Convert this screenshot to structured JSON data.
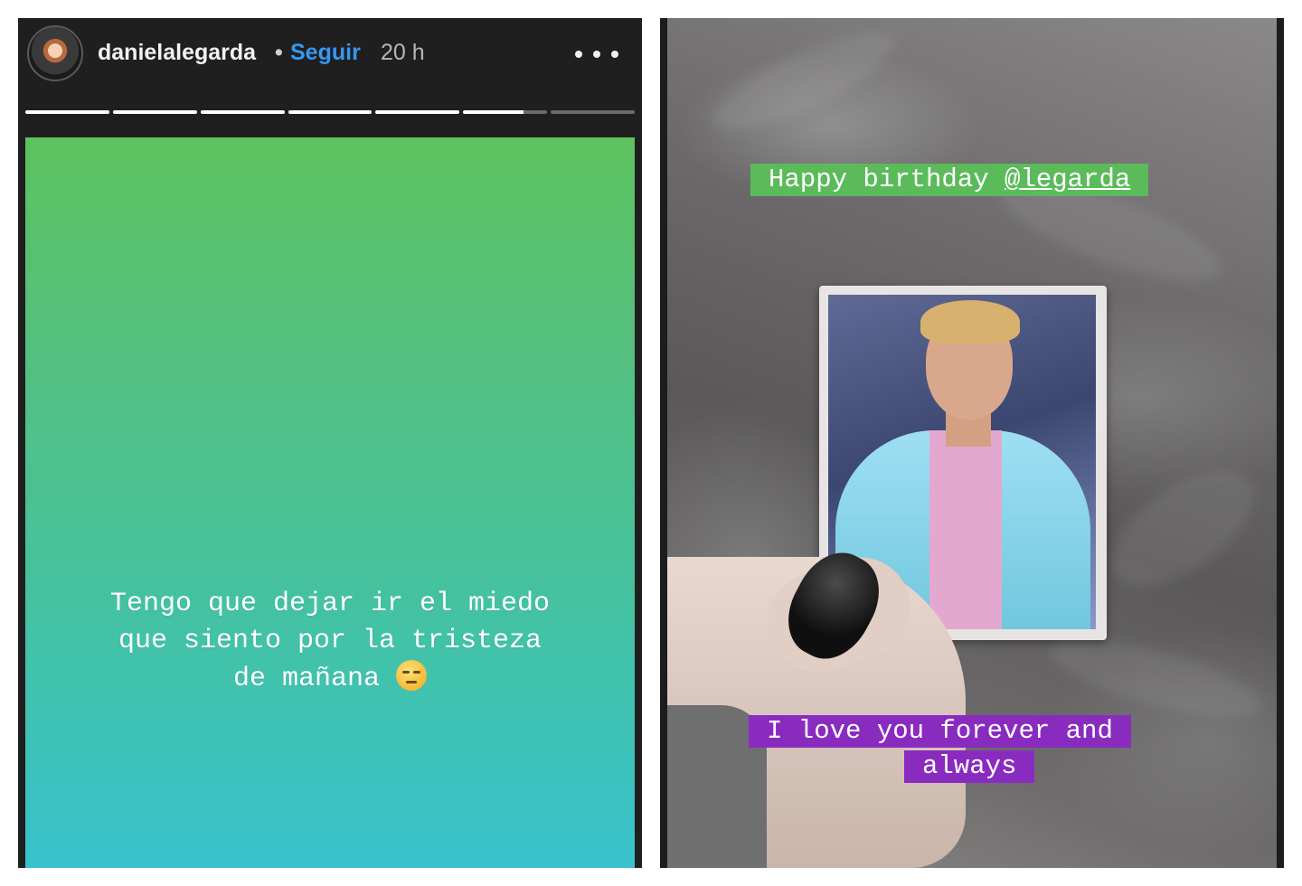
{
  "left_story": {
    "username": "danielalegarda",
    "separator": "•",
    "follow_label": "Seguir",
    "time": "20 h",
    "progress_segments": [
      1,
      1,
      1,
      1,
      1,
      0.72,
      0
    ],
    "caption_lines": [
      "Tengo que dejar ir el miedo",
      "que siento por la tristeza",
      "de mañana"
    ],
    "caption_emoji": "pensive-face-icon",
    "background_gradient": [
      "#5cc25e",
      "#38c2cd"
    ]
  },
  "right_story": {
    "mention_prefix": "Happy birthday ",
    "mention": "@legarda",
    "caption_lines": [
      "I love you forever and",
      "always"
    ],
    "colors": {
      "mention_bg": "#5bbb5a",
      "caption_bg": "#8a2bc0"
    }
  },
  "colors": {
    "follow": "#3897f0",
    "header_bg": "#1f1f20"
  }
}
